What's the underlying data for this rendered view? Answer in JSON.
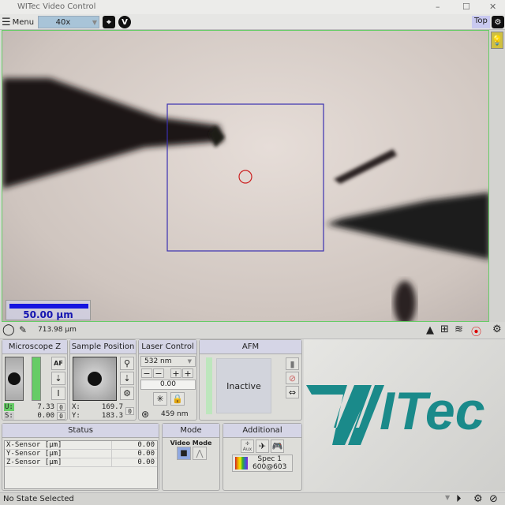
{
  "window": {
    "title": "WITec Video Control"
  },
  "toolbar": {
    "menu_label": "Menu",
    "magnification": "40x",
    "top_label": "Top"
  },
  "video": {
    "scale_bar_label": "50.00 µm",
    "colors": {
      "roi": "#3a30b0",
      "marker": "#cc2020",
      "scale_bar": "#1515e0"
    }
  },
  "video_bar": {
    "field_width": "713.98 µm"
  },
  "microscope_z": {
    "title": "Microscope Z",
    "af_label": "AF",
    "u_label": "U:",
    "u_value": "7.33",
    "u_zero": "0",
    "s_label": "S:",
    "s_value": "0.00",
    "s_zero": "0"
  },
  "sample_position": {
    "title": "Sample Position",
    "x_label": "X:",
    "x_value": "169.7",
    "y_label": "Y:",
    "y_value": "183.3",
    "zero": "0"
  },
  "laser_control": {
    "title": "Laser Control",
    "wavelength": "532 nm",
    "power": "0.00",
    "spot": "459 nm"
  },
  "afm": {
    "title": "AFM",
    "state": "Inactive"
  },
  "status": {
    "title": "Status",
    "rows": [
      {
        "label": "X-Sensor [µm]",
        "value": "0.00"
      },
      {
        "label": "Y-Sensor [µm]",
        "value": "0.00"
      },
      {
        "label": "Z-Sensor [µm]",
        "value": "0.00"
      }
    ]
  },
  "mode": {
    "title": "Mode",
    "label": "Video Mode"
  },
  "additional": {
    "title": "Additional",
    "aux_label": "Aux",
    "spec_name": "Spec 1",
    "spec_value": "600@603"
  },
  "logo": {
    "text": "WITec",
    "color": "#1a8a8a"
  },
  "statusbar": {
    "text": "No State Selected"
  }
}
